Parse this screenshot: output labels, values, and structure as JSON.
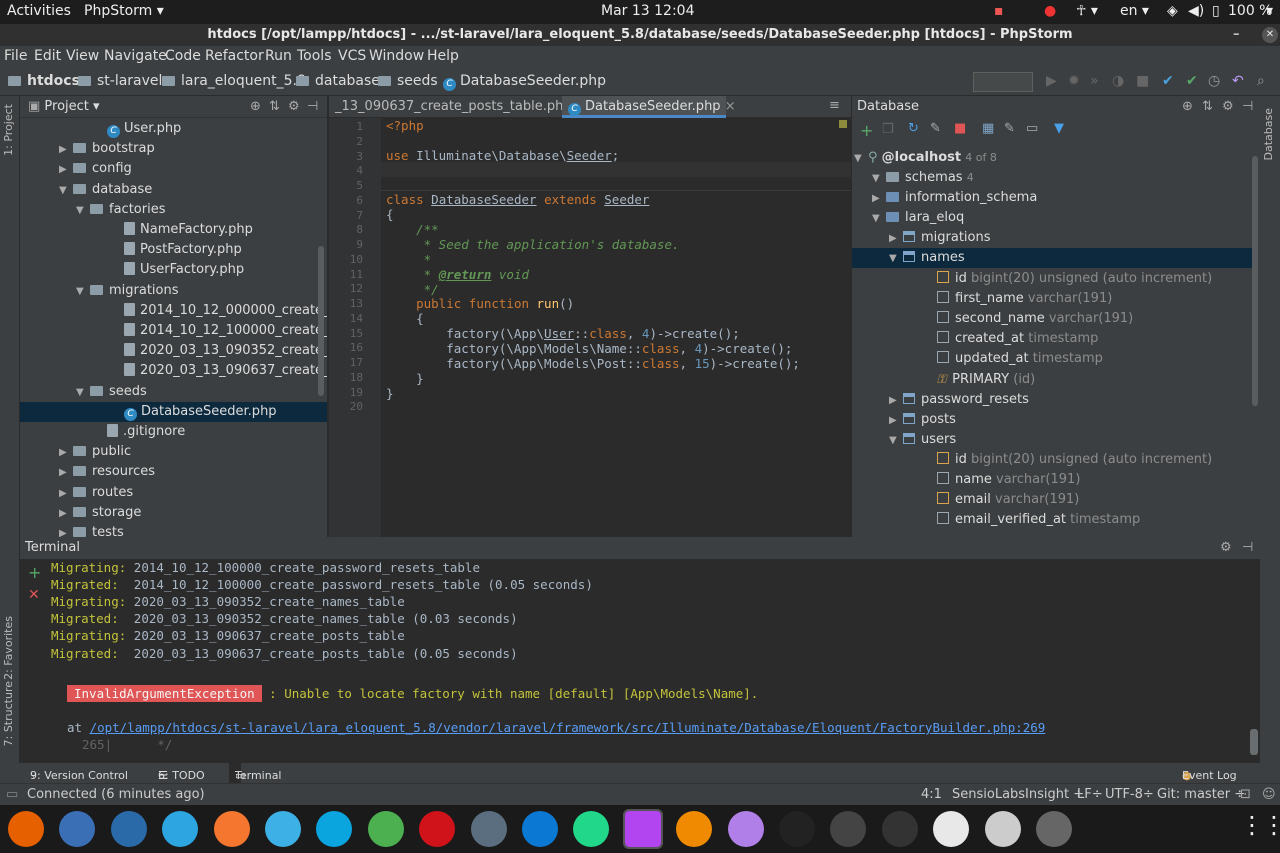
{
  "topbar": {
    "activities": "Activities",
    "app": "PhpStorm ▾",
    "clock": "Mar 13  12:04",
    "lang": "en ▾",
    "battery": "100 %"
  },
  "window": {
    "title": "htdocs [/opt/lampp/htdocs] - .../st-laravel/lara_eloquent_5.8/database/seeds/DatabaseSeeder.php [htdocs] - PhpStorm"
  },
  "menu": [
    "File",
    "Edit",
    "View",
    "Navigate",
    "Code",
    "Refactor",
    "Run",
    "Tools",
    "VCS",
    "Window",
    "Help"
  ],
  "breadcrumb": [
    "htdocs",
    "st-laravel",
    "lara_eloquent_5.8",
    "database",
    "seeds",
    "DatabaseSeeder.php"
  ],
  "project": {
    "title": "Project ▾",
    "tree": [
      {
        "label": "User.php",
        "indent": 5,
        "kind": "class"
      },
      {
        "label": "bootstrap",
        "indent": 3,
        "kind": "folder",
        "arrow": "▶"
      },
      {
        "label": "config",
        "indent": 3,
        "kind": "folder",
        "arrow": "▶"
      },
      {
        "label": "database",
        "indent": 3,
        "kind": "folder",
        "arrow": "▼"
      },
      {
        "label": "factories",
        "indent": 4,
        "kind": "folder",
        "arrow": "▼"
      },
      {
        "label": "NameFactory.php",
        "indent": 6,
        "kind": "file"
      },
      {
        "label": "PostFactory.php",
        "indent": 6,
        "kind": "file"
      },
      {
        "label": "UserFactory.php",
        "indent": 6,
        "kind": "file"
      },
      {
        "label": "migrations",
        "indent": 4,
        "kind": "folder",
        "arrow": "▼"
      },
      {
        "label": "2014_10_12_000000_create_use",
        "indent": 6,
        "kind": "file"
      },
      {
        "label": "2014_10_12_100000_create_pas",
        "indent": 6,
        "kind": "file"
      },
      {
        "label": "2020_03_13_090352_create_nan",
        "indent": 6,
        "kind": "file"
      },
      {
        "label": "2020_03_13_090637_create_pos",
        "indent": 6,
        "kind": "file"
      },
      {
        "label": "seeds",
        "indent": 4,
        "kind": "folder",
        "arrow": "▼"
      },
      {
        "label": "DatabaseSeeder.php",
        "indent": 6,
        "kind": "class",
        "selected": true
      },
      {
        "label": ".gitignore",
        "indent": 5,
        "kind": "file"
      },
      {
        "label": "public",
        "indent": 3,
        "kind": "folder",
        "arrow": "▶"
      },
      {
        "label": "resources",
        "indent": 3,
        "kind": "folder",
        "arrow": "▶"
      },
      {
        "label": "routes",
        "indent": 3,
        "kind": "folder",
        "arrow": "▶"
      },
      {
        "label": "storage",
        "indent": 3,
        "kind": "folder",
        "arrow": "▶"
      },
      {
        "label": "tests",
        "indent": 3,
        "kind": "folder",
        "arrow": "▶"
      }
    ]
  },
  "editor": {
    "tabs": [
      "_13_090637_create_posts_table.php",
      "DatabaseSeeder.php"
    ],
    "line_numbers": [
      "1",
      "2",
      "3",
      "4",
      "5",
      "6",
      "7",
      "8",
      "9",
      "10",
      "11",
      "12",
      "13",
      "14",
      "15",
      "16",
      "17",
      "18",
      "19",
      "20"
    ]
  },
  "database": {
    "title": "Database",
    "host": "@localhost",
    "host_count": "4 of 8",
    "schemas": "schemas",
    "schemas_count": "4",
    "tree": [
      {
        "label": "information_schema",
        "indent": 2,
        "kind": "schema",
        "arrow": "▶"
      },
      {
        "label": "lara_eloq",
        "indent": 2,
        "kind": "schema",
        "arrow": "▼"
      },
      {
        "label": "migrations",
        "indent": 3,
        "kind": "table",
        "arrow": "▶"
      },
      {
        "label": "names",
        "indent": 3,
        "kind": "table",
        "arrow": "▼",
        "selected": true
      },
      {
        "label": "id",
        "type": "bigint(20) unsigned (auto increment)",
        "indent": 5,
        "kind": "keycol"
      },
      {
        "label": "first_name",
        "type": "varchar(191)",
        "indent": 5,
        "kind": "col"
      },
      {
        "label": "second_name",
        "type": "varchar(191)",
        "indent": 5,
        "kind": "col"
      },
      {
        "label": "created_at",
        "type": "timestamp",
        "indent": 5,
        "kind": "col"
      },
      {
        "label": "updated_at",
        "type": "timestamp",
        "indent": 5,
        "kind": "col"
      },
      {
        "label": "PRIMARY",
        "type": "(id)",
        "indent": 5,
        "kind": "key"
      },
      {
        "label": "password_resets",
        "indent": 3,
        "kind": "table",
        "arrow": "▶"
      },
      {
        "label": "posts",
        "indent": 3,
        "kind": "table",
        "arrow": "▶"
      },
      {
        "label": "users",
        "indent": 3,
        "kind": "table",
        "arrow": "▼"
      },
      {
        "label": "id",
        "type": "bigint(20) unsigned (auto increment)",
        "indent": 5,
        "kind": "keycol"
      },
      {
        "label": "name",
        "type": "varchar(191)",
        "indent": 5,
        "kind": "col"
      },
      {
        "label": "email",
        "type": "varchar(191)",
        "indent": 5,
        "kind": "keycol"
      },
      {
        "label": "email_verified_at",
        "type": "timestamp",
        "indent": 5,
        "kind": "col"
      }
    ]
  },
  "terminal": {
    "title": "Terminal",
    "lines": [
      {
        "tag": "Migrating:",
        "text": " 2014_10_12_100000_create_password_resets_table"
      },
      {
        "tag": "Migrated: ",
        "text": " 2014_10_12_100000_create_password_resets_table (0.05 seconds)"
      },
      {
        "tag": "Migrating:",
        "text": " 2020_03_13_090352_create_names_table"
      },
      {
        "tag": "Migrated: ",
        "text": " 2020_03_13_090352_create_names_table (0.03 seconds)"
      },
      {
        "tag": "Migrating:",
        "text": " 2020_03_13_090637_create_posts_table"
      },
      {
        "tag": "Migrated: ",
        "text": " 2020_03_13_090637_create_posts_table (0.05 seconds)"
      }
    ],
    "exception": "InvalidArgumentException",
    "exception_msg": " : Unable to locate factory with name [default] [App\\Models\\Name].",
    "at": "at ",
    "path": "/opt/lampp/htdocs/st-laravel/lara_eloquent_5.8/vendor/laravel/framework/src/Illuminate/Database/Eloquent/FactoryBuilder.php:269",
    "snippet": "265|      */"
  },
  "bottom_tabs": {
    "vc": "9: Version Control",
    "todo": "6: TODO",
    "terminal": "Terminal",
    "eventlog": "Event Log"
  },
  "side_tabs": {
    "project": "1: Project",
    "favorites": "2: Favorites",
    "structure": "7: Structure",
    "database": "Database"
  },
  "status": {
    "left": "Connected (6 minutes ago)",
    "pos": "4:1",
    "plugin": "SensioLabsInsight ÷",
    "lf": "LF÷",
    "enc": "UTF-8÷",
    "git": "Git: master ÷"
  },
  "dock_colors": [
    "#e66000",
    "#3a6fb5",
    "#2a6aa8",
    "#2ca5e0",
    "#f5762e",
    "#3db0e5",
    "#0aa4de",
    "#4caf50",
    "#d0121b",
    "#5a6e7f",
    "#0b78d4",
    "#21d789",
    "#b345f1",
    "#f08a00",
    "#b080e8",
    "#222",
    "#444",
    "#333",
    "#e8e8e8",
    "#ccc",
    "#666"
  ]
}
